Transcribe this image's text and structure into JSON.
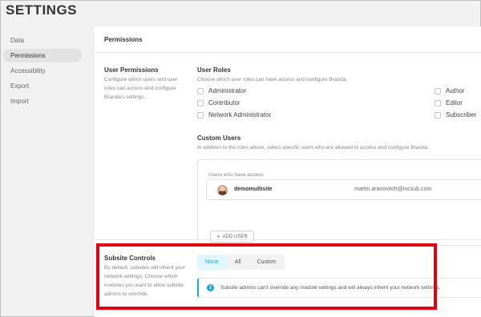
{
  "page": {
    "title": "SETTINGS"
  },
  "sidebar": {
    "items": [
      {
        "label": "Data"
      },
      {
        "label": "Permissions",
        "active": true
      },
      {
        "label": "Accessibility"
      },
      {
        "label": "Export"
      },
      {
        "label": "Import"
      }
    ]
  },
  "card": {
    "title": "Permissions"
  },
  "user_permissions": {
    "label": "User Permissions",
    "desc_lines": [
      "Configure which users and user",
      "roles can access and configure",
      "Branda's settings."
    ]
  },
  "user_roles": {
    "label": "User Roles",
    "desc": "Choose which user roles can have access and configure Branda.",
    "roles": [
      "Administrator",
      "Contributor",
      "Network Administrator",
      "Author",
      "Editor",
      "Subscriber"
    ]
  },
  "custom_users": {
    "label": "Custom Users",
    "desc": "In addition to the roles above, select specific users who are allowed to access and configure Branda.",
    "access_label": "Users who have access",
    "users": [
      {
        "name": "demomultisite",
        "email": "martin.aranovitch@incsub.com"
      }
    ],
    "add_button": "ADD USER"
  },
  "subsite_controls": {
    "label": "Subsite Controls",
    "desc_lines": [
      "By default, subsites will inherit your",
      "network settings. Choose which",
      "modules you want to allow subsite",
      "admins to override."
    ],
    "tabs": [
      {
        "label": "None",
        "active": true
      },
      {
        "label": "All"
      },
      {
        "label": "Custom"
      }
    ],
    "notice": "Subsite admins can't override any module settings and will always inherit your network settings."
  },
  "colors": {
    "accent": "#17a8e3",
    "highlight": "#e3000f",
    "active_tab_bg": "#e1f6ff"
  },
  "icons": {
    "notice": "info-icon",
    "add": "plus-icon"
  }
}
